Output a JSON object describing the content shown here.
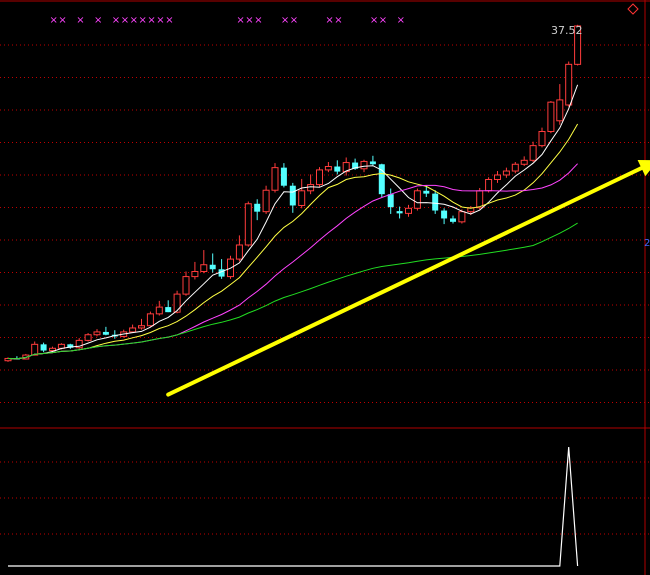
{
  "chart_data": {
    "type": "candlestick",
    "price_label": "37.52",
    "edge_label": "2",
    "top_marker_glyph": "×",
    "top_markers": [
      5,
      6,
      8,
      10,
      12,
      13,
      14,
      15,
      16,
      17,
      18,
      26,
      27,
      28,
      31,
      32,
      36,
      37,
      41,
      42,
      44
    ],
    "candles": [
      [
        10.0,
        10.6,
        9.8,
        10.4
      ],
      [
        10.4,
        10.8,
        10.2,
        10.3
      ],
      [
        10.3,
        11.2,
        10.2,
        11.0
      ],
      [
        11.0,
        13.4,
        10.9,
        12.9
      ],
      [
        12.9,
        13.2,
        11.5,
        11.8
      ],
      [
        11.8,
        12.5,
        11.4,
        12.2
      ],
      [
        12.2,
        13.1,
        12.0,
        12.9
      ],
      [
        12.9,
        13.0,
        12.1,
        12.3
      ],
      [
        12.3,
        14.0,
        12.1,
        13.6
      ],
      [
        13.6,
        14.9,
        13.4,
        14.6
      ],
      [
        14.6,
        15.6,
        14.3,
        15.1
      ],
      [
        15.1,
        16.0,
        14.5,
        14.6
      ],
      [
        14.6,
        15.4,
        13.9,
        14.3
      ],
      [
        14.3,
        15.5,
        14.1,
        15.1
      ],
      [
        15.1,
        16.4,
        15.0,
        15.8
      ],
      [
        15.8,
        17.4,
        15.5,
        16.2
      ],
      [
        16.2,
        18.7,
        16.0,
        18.3
      ],
      [
        18.3,
        20.6,
        18.0,
        19.5
      ],
      [
        19.5,
        20.7,
        18.6,
        18.6
      ],
      [
        18.6,
        22.4,
        18.4,
        21.8
      ],
      [
        21.8,
        25.8,
        21.5,
        24.9
      ],
      [
        24.9,
        27.5,
        24.4,
        25.8
      ],
      [
        25.8,
        29.6,
        25.5,
        27.0
      ],
      [
        27.0,
        29.0,
        25.6,
        26.2
      ],
      [
        26.2,
        28.0,
        24.5,
        24.9
      ],
      [
        24.9,
        28.6,
        24.5,
        28.0
      ],
      [
        28.0,
        32.2,
        27.6,
        30.5
      ],
      [
        30.5,
        38.2,
        30.2,
        37.8
      ],
      [
        37.8,
        38.6,
        34.9,
        36.4
      ],
      [
        36.4,
        41.0,
        36.0,
        40.2
      ],
      [
        40.2,
        45.0,
        39.8,
        44.2
      ],
      [
        44.2,
        45.0,
        40.7,
        41.0
      ],
      [
        41.0,
        41.5,
        36.2,
        37.5
      ],
      [
        37.5,
        42.2,
        37.0,
        40.1
      ],
      [
        40.1,
        43.0,
        39.5,
        41.2
      ],
      [
        41.2,
        44.3,
        40.8,
        43.8
      ],
      [
        43.8,
        45.2,
        43.4,
        44.4
      ],
      [
        44.4,
        45.5,
        43.0,
        43.5
      ],
      [
        43.5,
        46.0,
        42.8,
        45.1
      ],
      [
        45.1,
        45.8,
        43.8,
        44.0
      ],
      [
        44.0,
        45.6,
        43.4,
        45.3
      ],
      [
        45.3,
        46.3,
        44.6,
        44.8
      ],
      [
        44.8,
        44.9,
        39.0,
        39.5
      ],
      [
        39.5,
        40.5,
        36.0,
        37.2
      ],
      [
        36.5,
        37.3,
        35.2,
        36.1
      ],
      [
        36.1,
        37.6,
        35.5,
        37.0
      ],
      [
        37.0,
        40.5,
        36.6,
        40.1
      ],
      [
        40.1,
        41.0,
        39.0,
        39.6
      ],
      [
        39.6,
        40.2,
        36.0,
        36.6
      ],
      [
        36.6,
        37.0,
        34.2,
        35.2
      ],
      [
        35.2,
        35.7,
        34.3,
        34.6
      ],
      [
        34.6,
        36.8,
        34.3,
        36.4
      ],
      [
        36.4,
        37.4,
        35.8,
        37.1
      ],
      [
        37.1,
        40.6,
        36.8,
        40.1
      ],
      [
        40.1,
        42.5,
        39.8,
        42.1
      ],
      [
        42.1,
        43.6,
        41.5,
        42.9
      ],
      [
        42.9,
        44.2,
        42.4,
        43.6
      ],
      [
        43.6,
        45.2,
        43.2,
        44.8
      ],
      [
        44.8,
        46.2,
        44.5,
        45.5
      ],
      [
        45.5,
        48.8,
        45.2,
        48.1
      ],
      [
        48.1,
        51.3,
        47.8,
        50.6
      ],
      [
        50.6,
        56.0,
        50.3,
        55.8
      ],
      [
        52.5,
        59.0,
        51.8,
        56.2
      ],
      [
        55.3,
        63.0,
        55.0,
        62.5
      ],
      [
        62.5,
        69.5,
        62.3,
        69.3
      ]
    ],
    "ma_series": [
      {
        "color": "#ffffff",
        "period": 5
      },
      {
        "color": "#ffff44",
        "period": 10
      },
      {
        "color": "#ff44ff",
        "period": 20
      },
      {
        "color": "#22dd22",
        "period": 60
      }
    ],
    "trend_arrow": {
      "color": "#ffff00",
      "from_index": 18,
      "to_index": 73,
      "from_price": 4.0,
      "to_price": 45.5
    },
    "indicator": {
      "spike_index": 63,
      "max": 1
    }
  }
}
